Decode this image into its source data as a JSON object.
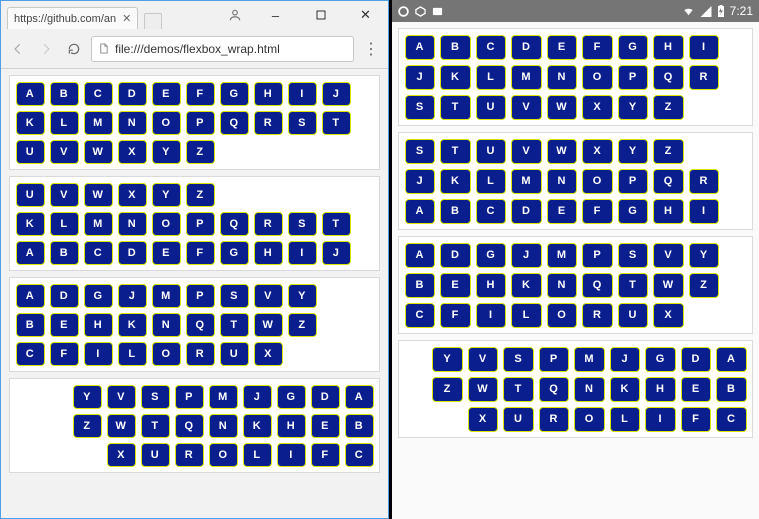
{
  "browser": {
    "tab_title": "https://github.com/an",
    "address": "file:///demos/flexbox_wrap.html",
    "window_controls": {
      "minimize": "–",
      "maximize": "▢",
      "close": "✕"
    }
  },
  "android": {
    "time": "7:21",
    "signal_icon": "signal",
    "battery_icon": "battery"
  },
  "alphabet": [
    "A",
    "B",
    "C",
    "D",
    "E",
    "F",
    "G",
    "H",
    "I",
    "J",
    "K",
    "L",
    "M",
    "N",
    "O",
    "P",
    "Q",
    "R",
    "S",
    "T",
    "U",
    "V",
    "W",
    "X",
    "Y",
    "Z"
  ],
  "panels": {
    "browser": [
      {
        "mode": "wrap",
        "cols": 10,
        "source": "alphabet"
      },
      {
        "mode": "wrap-reverse",
        "cols": 10,
        "source": "alphabet"
      },
      {
        "mode": "wrap-cols",
        "cols": 9,
        "source": "alphabet"
      },
      {
        "mode": "wrap-reverse-end",
        "cols": 9,
        "source": "alphabet"
      }
    ],
    "android": [
      {
        "mode": "wrap",
        "cols": 10,
        "source": "alphabet"
      },
      {
        "mode": "wrap-reverse",
        "cols": 10,
        "source": "alphabet"
      },
      {
        "mode": "wrap-cols",
        "cols": 9,
        "source": "alphabet"
      },
      {
        "mode": "wrap-reverse-end",
        "cols": 9,
        "source": "alphabet"
      }
    ]
  }
}
